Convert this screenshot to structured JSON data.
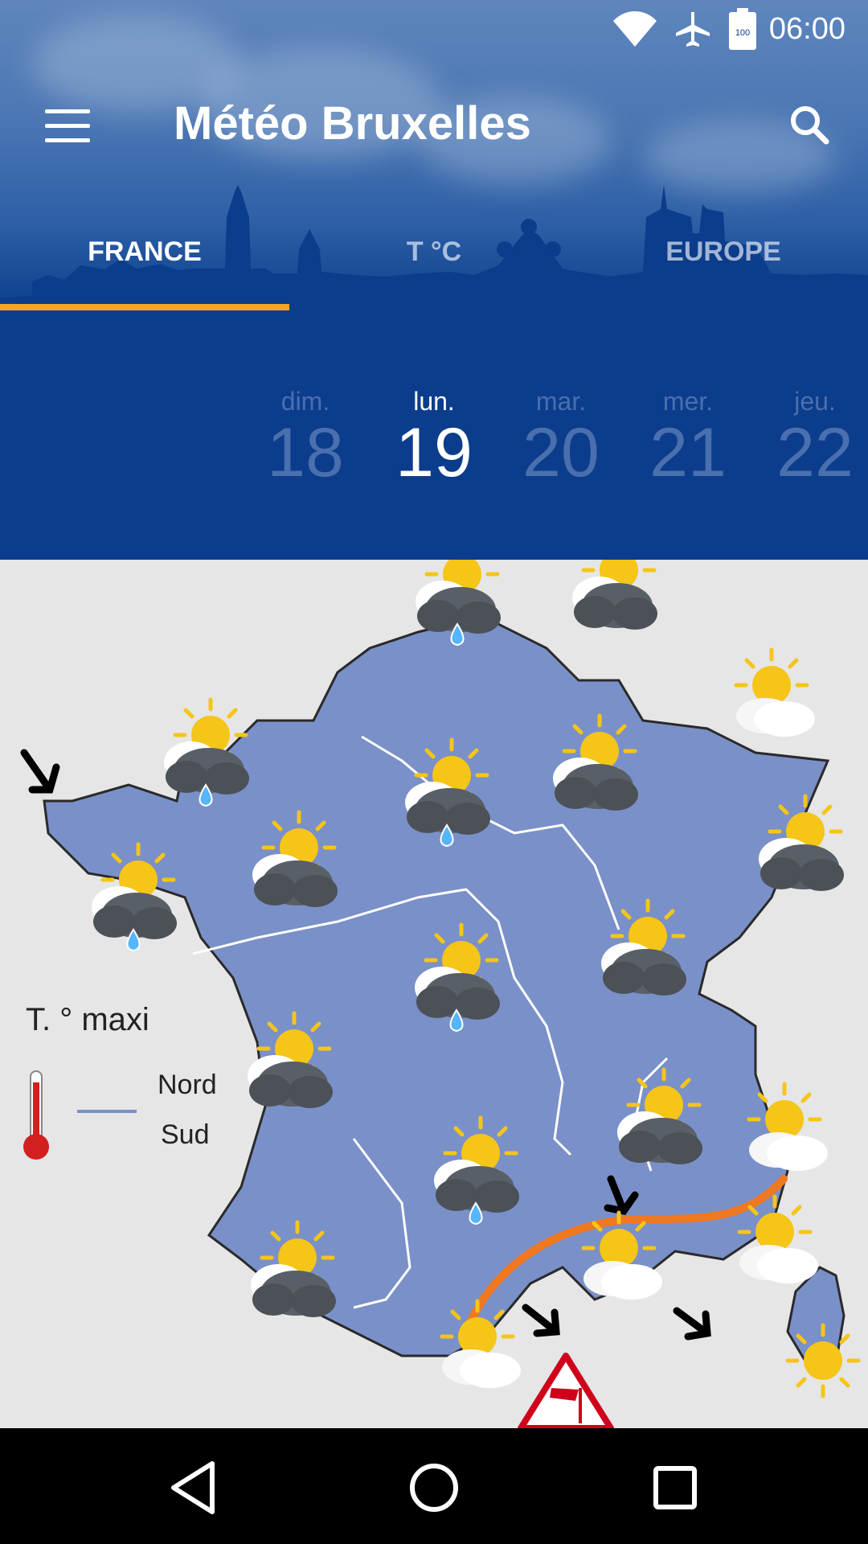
{
  "status": {
    "time": "06:00",
    "battery": "100"
  },
  "toolbar": {
    "title": "Météo Bruxelles"
  },
  "tabs": [
    {
      "label": "FRANCE",
      "active": true
    },
    {
      "label": "T °C",
      "active": false
    },
    {
      "label": "EUROPE",
      "active": false
    }
  ],
  "days": [
    {
      "name": "dim.",
      "num": "18"
    },
    {
      "name": "lun.",
      "num": "19",
      "selected": true
    },
    {
      "name": "mar.",
      "num": "20"
    },
    {
      "name": "mer.",
      "num": "21"
    },
    {
      "name": "jeu.",
      "num": "22"
    }
  ],
  "map": {
    "legend_title": "T. ° maxi",
    "legend_nord": "Nord",
    "legend_sud": "Sud"
  },
  "colors": {
    "primary": "#0b3d8c",
    "tab_indicator": "#f5a623",
    "land": "#7a90c8",
    "front": "#f07820"
  }
}
